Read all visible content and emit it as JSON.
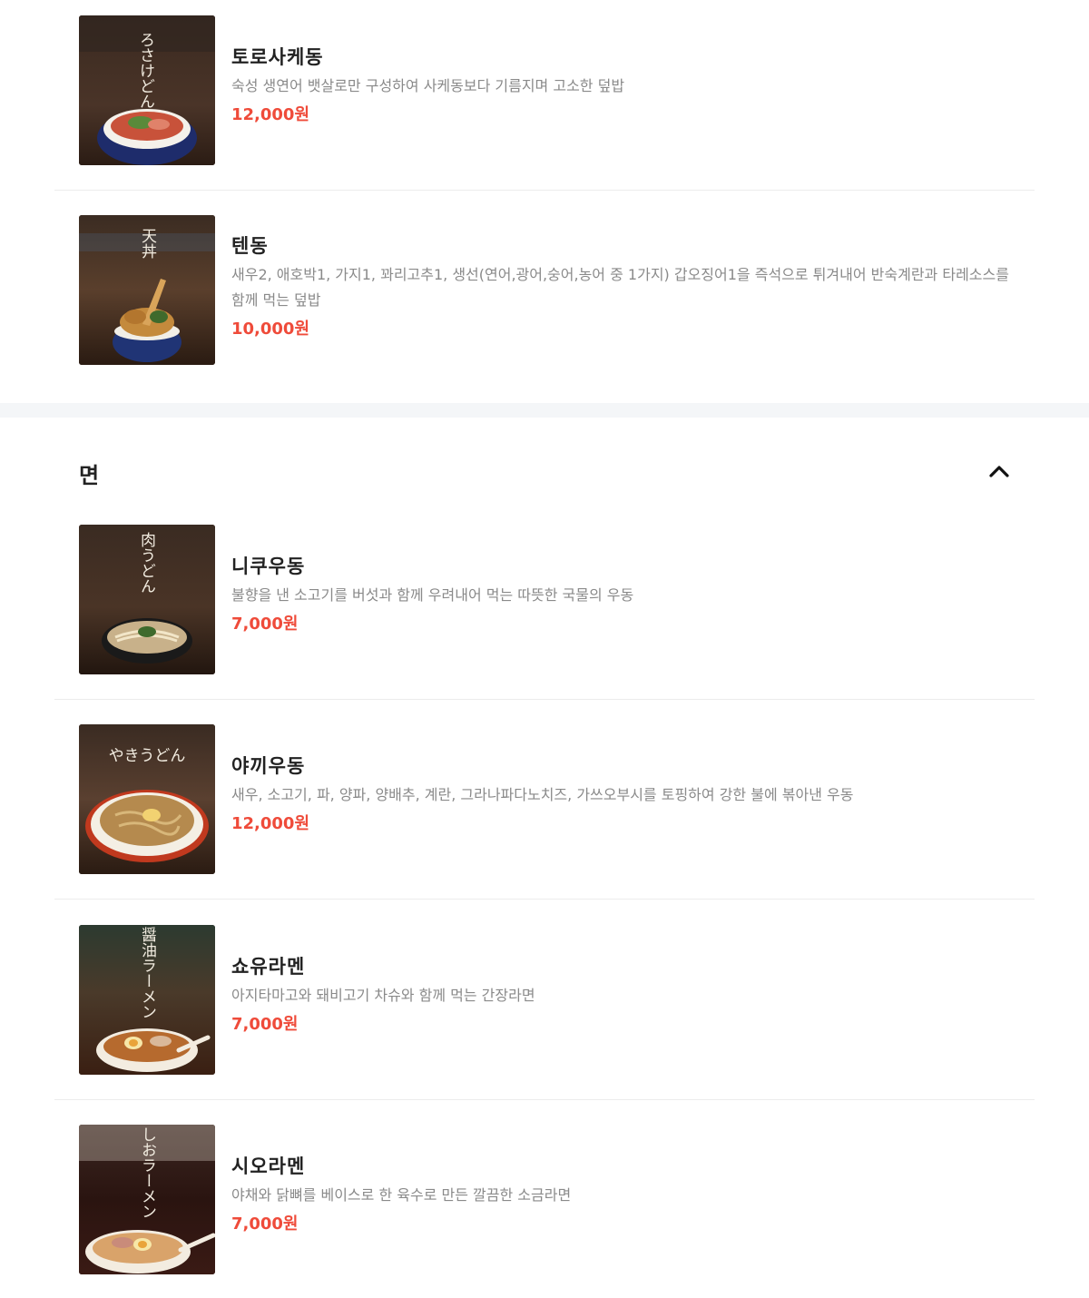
{
  "colors": {
    "price": "#ef4b3a",
    "description": "#8a8a8a",
    "title": "#222222",
    "section_band": "#f4f6f8"
  },
  "categories": [
    {
      "items": [
        {
          "name": "토로사케동",
          "description": "숙성 생연어 뱃살로만 구성하여 사케동보다 기름지며 고소한 덮밥",
          "price": "12,000원",
          "image_text": "ろさけどん"
        },
        {
          "name": "텐동",
          "description": "새우2, 애호박1, 가지1, 꽈리고추1, 생선(연어,광어,숭어,농어 중 1가지) 갑오징어1을 즉석으로 튀겨내어 반숙계란과 타레소스를 함께 먹는 덮밥",
          "price": "10,000원",
          "image_text": "天丼"
        }
      ]
    },
    {
      "title": "면",
      "toggle_icon": "chevron-up-icon",
      "items": [
        {
          "name": "니쿠우동",
          "description": "불향을 낸 소고기를 버섯과 함께 우려내어 먹는 따뜻한 국물의 우동",
          "price": "7,000원",
          "image_text": "肉うどん"
        },
        {
          "name": "야끼우동",
          "description": "새우, 소고기, 파, 양파, 양배추, 계란, 그라나파다노치즈, 가쓰오부시를 토핑하여 강한 불에 볶아낸 우동",
          "price": "12,000원",
          "image_text": "やきうどん"
        },
        {
          "name": "쇼유라멘",
          "description": "아지타마고와 돼비고기 차슈와 함께 먹는 간장라면",
          "price": "7,000원",
          "image_text": "醤油ラーメン"
        },
        {
          "name": "시오라멘",
          "description": "야채와 닭뼈를 베이스로 한 육수로 만든 깔끔한 소금라면",
          "price": "7,000원",
          "image_text": "しおラーメン"
        }
      ]
    }
  ]
}
